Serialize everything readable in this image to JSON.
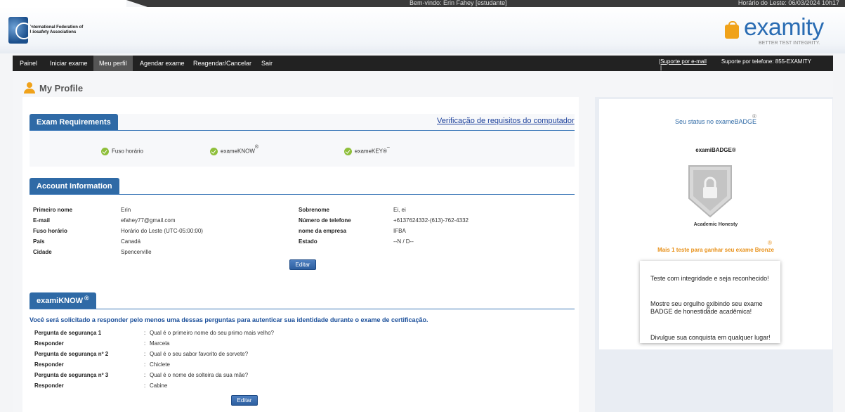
{
  "topbar": {
    "welcome": "Bem-vindo: Erin Fahey [estudante]",
    "clock": "Horário do Leste: 06/03/2024 10h17"
  },
  "header": {
    "org_logo_text": "International Federation of Biosafety Associations",
    "brand_name": "examity",
    "brand_tagline": "BETTER TEST INTEGRITY."
  },
  "nav": {
    "items": [
      "Painel",
      "Iniciar exame",
      "Meu perfil",
      "Agendar exame",
      "Reagendar/Cancelar",
      "Sair"
    ],
    "active": "Meu perfil",
    "support_email": "|Suporte por e-mail",
    "support_phone": "Suporte por telefone: 855-EXAMITY",
    "support_pipe": "|"
  },
  "page": {
    "title": "My Profile"
  },
  "requirements": {
    "tab": "Exam Requirements",
    "check_link": "Verificação de requisitos do computador",
    "items": [
      "Fuso horário",
      "exameKNOW",
      "exameKEY®"
    ],
    "know_sup": "®",
    "key_sup": "–"
  },
  "account": {
    "tab": "Account Information",
    "left": [
      {
        "label": "Primeiro nome",
        "value": "Erin"
      },
      {
        "label": "E-mail",
        "value": "efahey77@gmail.com"
      },
      {
        "label": "Fuso horário",
        "value": "Horário do Leste (UTC-05:00:00)"
      },
      {
        "label": "País",
        "value": "Canadá"
      },
      {
        "label": "Cidade",
        "value": "Spencerville"
      }
    ],
    "right": [
      {
        "label": "Sobrenome",
        "value": "Ei, ei"
      },
      {
        "label": "Número de telefone",
        "value": "+6137624332-(613)-762-4332"
      },
      {
        "label": "nome da empresa",
        "value": "IFBA"
      },
      {
        "label": "Estado",
        "value": "--N / D--"
      }
    ],
    "edit": "Editar"
  },
  "examiknow": {
    "tab": "examiKNOW",
    "tab_sup": "®",
    "intro": "Você será solicitado a responder pelo menos uma dessas perguntas para autenticar sua identidade durante o exame de certificação.",
    "rows": [
      {
        "label": "Pergunta de segurança 1",
        "value": "Qual é o primeiro nome do seu primo mais velho?"
      },
      {
        "label": "Responder",
        "value": "Marcela"
      },
      {
        "label": "Pergunta de segurança nº 2",
        "value": "Qual é o seu sabor favorito de sorvete?"
      },
      {
        "label": "Responder",
        "value": "Chiclete"
      },
      {
        "label": "Pergunta de segurança nº 3",
        "value": "Qual é o nome de solteira da sua mãe?"
      },
      {
        "label": "Responder",
        "value": "Cabine"
      }
    ],
    "separator": ":",
    "edit": "Editar"
  },
  "sidebar": {
    "status_title": "Seu status no exameBADGE",
    "status_sup": "®",
    "badge_title": "examiBADGE®",
    "badge_caption": "Academic Honesty",
    "bronze_text": "Mais 1 teste para ganhar seu exame Bronze",
    "bronze_sup": "®",
    "tip_line1": "Teste com integridade e seja reconhecido!",
    "tip_line2": "Mostre seu orgulho exibindo seu exame BADGE  de honestidade acadêmica!",
    "tip_line2_sup": "®",
    "tip_line3": "Divulgue sua conquista em qualquer lugar!"
  },
  "colors": {
    "nav_bg": "#222222",
    "tab_blue": "#2f6aa6",
    "accent_orange": "#f0a21a",
    "check_green": "#8fbf3b",
    "link_blue": "#1b3f9a"
  }
}
